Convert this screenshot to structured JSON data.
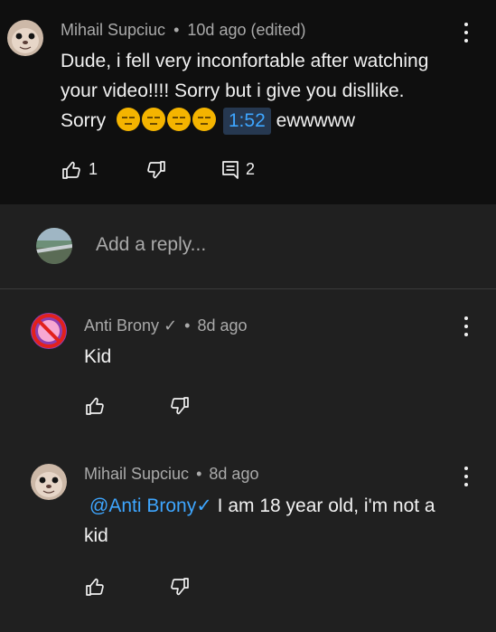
{
  "main_comment": {
    "author": "Mihail Supciuc",
    "time": "10d ago (edited)",
    "text_line1": "Dude, i fell very inconfortable after watching",
    "text_line2": "your video!!!! Sorry but i give you disllike.",
    "text_line3_pre": "Sorry",
    "timestamp": "1:52",
    "text_line3_post": "ewwwww",
    "like_count": "1",
    "reply_count": "2"
  },
  "reply_input": {
    "placeholder": "Add a reply..."
  },
  "replies": [
    {
      "author": "Anti Brony",
      "verified": "✓",
      "time": "8d ago",
      "text": "Kid"
    },
    {
      "author": "Mihail Supciuc",
      "time": "8d ago",
      "mention": "@Anti Brony",
      "verified": "✓",
      "text_line1": "I am 18 year old, i'm not a",
      "text_line2": "kid"
    }
  ],
  "separator": "•",
  "icons": [
    "more-vert-icon",
    "thumb-up-icon",
    "thumb-down-icon",
    "comment-icon"
  ],
  "colors": {
    "link": "#3ea6ff",
    "bg_dark": "#0f0f0f",
    "bg": "#202020"
  }
}
